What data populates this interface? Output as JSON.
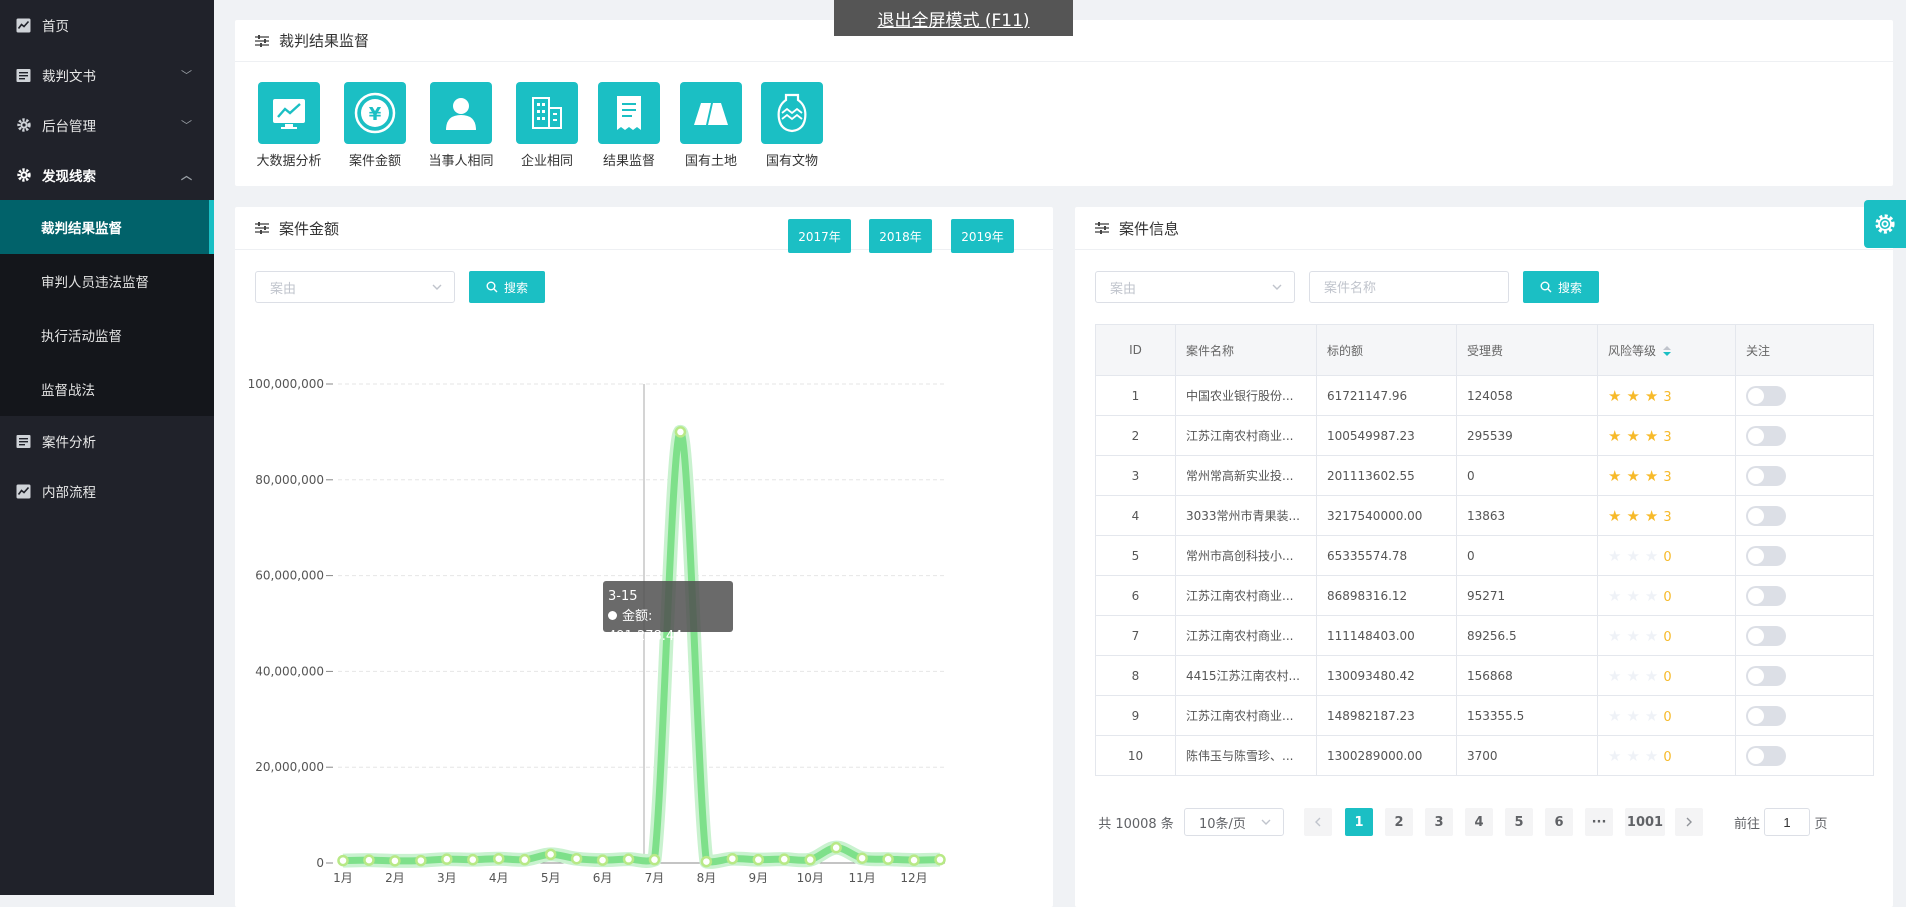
{
  "sidebar": {
    "items": [
      {
        "label": "首页",
        "icon": "chart-icon"
      },
      {
        "label": "裁判文书",
        "icon": "document-icon",
        "arrow": "down"
      },
      {
        "label": "后台管理",
        "icon": "gear-icon",
        "arrow": "down"
      },
      {
        "label": "发现线索",
        "icon": "gear-icon",
        "arrow": "up"
      }
    ],
    "sub_items": [
      {
        "label": "裁判结果监督",
        "active": true
      },
      {
        "label": "审判人员违法监督"
      },
      {
        "label": "执行活动监督"
      },
      {
        "label": "监督战法"
      }
    ],
    "items_after": [
      {
        "label": "案件分析",
        "icon": "document-icon"
      },
      {
        "label": "内部流程",
        "icon": "chart-icon"
      }
    ]
  },
  "fullscreen_banner": "退出全屏模式 (F11)",
  "top_card": {
    "title": "裁判结果监督",
    "tiles": [
      {
        "label": "大数据分析",
        "icon": "trend-chart-icon"
      },
      {
        "label": "案件金额",
        "icon": "yuan-coin-icon"
      },
      {
        "label": "当事人相同",
        "icon": "person-icon"
      },
      {
        "label": "企业相同",
        "icon": "building-icon"
      },
      {
        "label": "结果监督",
        "icon": "receipt-icon"
      },
      {
        "label": "国有土地",
        "icon": "land-icon"
      },
      {
        "label": "国有文物",
        "icon": "vase-icon"
      }
    ]
  },
  "amount_card": {
    "title": "案件金额",
    "years": [
      "2017年",
      "2018年",
      "2019年"
    ],
    "filter_placeholder": "案由",
    "search_label": "搜索",
    "tooltip": {
      "date": "3-15",
      "series": "金额",
      "value": "491,278.44"
    }
  },
  "chart_data": {
    "type": "line",
    "title": "",
    "xlabel": "",
    "ylabel": "",
    "ylim": [
      0,
      100000000
    ],
    "yticks": [
      "0",
      "20,000,000",
      "40,000,000",
      "60,000,000",
      "80,000,000",
      "100,000,000"
    ],
    "month_ticks": [
      "1月",
      "2月",
      "3月",
      "4月",
      "5月",
      "6月",
      "7月",
      "8月",
      "9月",
      "10月",
      "11月",
      "12月"
    ],
    "series": [
      {
        "name": "金额",
        "values": [
          500000,
          600000,
          450000,
          500000,
          800000,
          700000,
          900000,
          700000,
          1800000,
          900000,
          600000,
          800000,
          700000,
          90000000,
          300000,
          900000,
          700000,
          800000,
          700000,
          3200000,
          1000000,
          800000,
          600000,
          700000
        ]
      }
    ],
    "color": "#7ee08a",
    "grid": true
  },
  "case_card": {
    "title": "案件信息",
    "filter_placeholder": "案由",
    "name_placeholder": "案件名称",
    "search_label": "搜索",
    "columns": [
      "ID",
      "案件名称",
      "标的额",
      "受理费",
      "风险等级",
      "关注"
    ],
    "rows": [
      {
        "id": "1",
        "name": "中国农业银行股份...",
        "amount": "61721147.96",
        "fee": "124058",
        "stars": 3,
        "level": "3"
      },
      {
        "id": "2",
        "name": "江苏江南农村商业...",
        "amount": "100549987.23",
        "fee": "295539",
        "stars": 3,
        "level": "3"
      },
      {
        "id": "3",
        "name": "常州常高新实业投...",
        "amount": "201113602.55",
        "fee": "0",
        "stars": 3,
        "level": "3"
      },
      {
        "id": "4",
        "name": "3033常州市青果装...",
        "amount": "3217540000.00",
        "fee": "13863",
        "stars": 3,
        "level": "3"
      },
      {
        "id": "5",
        "name": "常州市高创科技小...",
        "amount": "65335574.78",
        "fee": "0",
        "stars": 0,
        "level": "0"
      },
      {
        "id": "6",
        "name": "江苏江南农村商业...",
        "amount": "86898316.12",
        "fee": "95271",
        "stars": 0,
        "level": "0"
      },
      {
        "id": "7",
        "name": "江苏江南农村商业...",
        "amount": "111148403.00",
        "fee": "89256.5",
        "stars": 0,
        "level": "0"
      },
      {
        "id": "8",
        "name": "4415江苏江南农村...",
        "amount": "130093480.42",
        "fee": "156868",
        "stars": 0,
        "level": "0"
      },
      {
        "id": "9",
        "name": "江苏江南农村商业...",
        "amount": "148982187.23",
        "fee": "153355.5",
        "stars": 0,
        "level": "0"
      },
      {
        "id": "10",
        "name": "陈伟玉与陈雪珍、...",
        "amount": "1300289000.00",
        "fee": "3700",
        "stars": 0,
        "level": "0"
      }
    ],
    "pagination": {
      "total": "共 10008 条",
      "page_size": "10条/页",
      "pages": [
        "1",
        "2",
        "3",
        "4",
        "5",
        "6",
        "···",
        "1001"
      ],
      "current": "1",
      "goto_prefix": "前往",
      "goto_value": "1",
      "goto_suffix": "页"
    }
  },
  "accent_color": "#1bbfc4"
}
